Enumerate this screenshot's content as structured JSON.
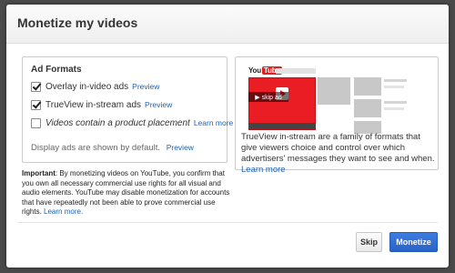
{
  "dialog": {
    "title": "Monetize my videos"
  },
  "ad_formats": {
    "title": "Ad Formats",
    "items": [
      {
        "label": "Overlay in-video ads",
        "checked": true,
        "link": "Preview",
        "italic": false
      },
      {
        "label": "TrueView in-stream ads",
        "checked": true,
        "link": "Preview",
        "italic": false
      },
      {
        "label": "Videos contain a product placement",
        "checked": false,
        "link": "Learn more",
        "italic": true
      }
    ],
    "display_note": "Display ads are shown by default.",
    "display_link": "Preview"
  },
  "preview": {
    "logo_you": "You",
    "logo_tube": "Tube",
    "skip_ad_label": "▶ skip ad",
    "description": "TrueView in-stream are a family of formats that give viewers choice and control over which advertisers' messages they want to see and when.",
    "description_link": "Learn more"
  },
  "important": {
    "label": "Important",
    "text": ": By monetizing videos on YouTube, you confirm that you own all necessary commercial use rights for all visual and audio elements. YouTube may disable monetization for accounts that have repeatedly not been able to prove commercial use rights.",
    "link": "Learn more."
  },
  "buttons": {
    "skip": "Skip",
    "monetize": "Monetize"
  },
  "colors": {
    "link": "#1c62b9",
    "primary_button": "#2863c8",
    "player_red": "#ea1c24"
  }
}
